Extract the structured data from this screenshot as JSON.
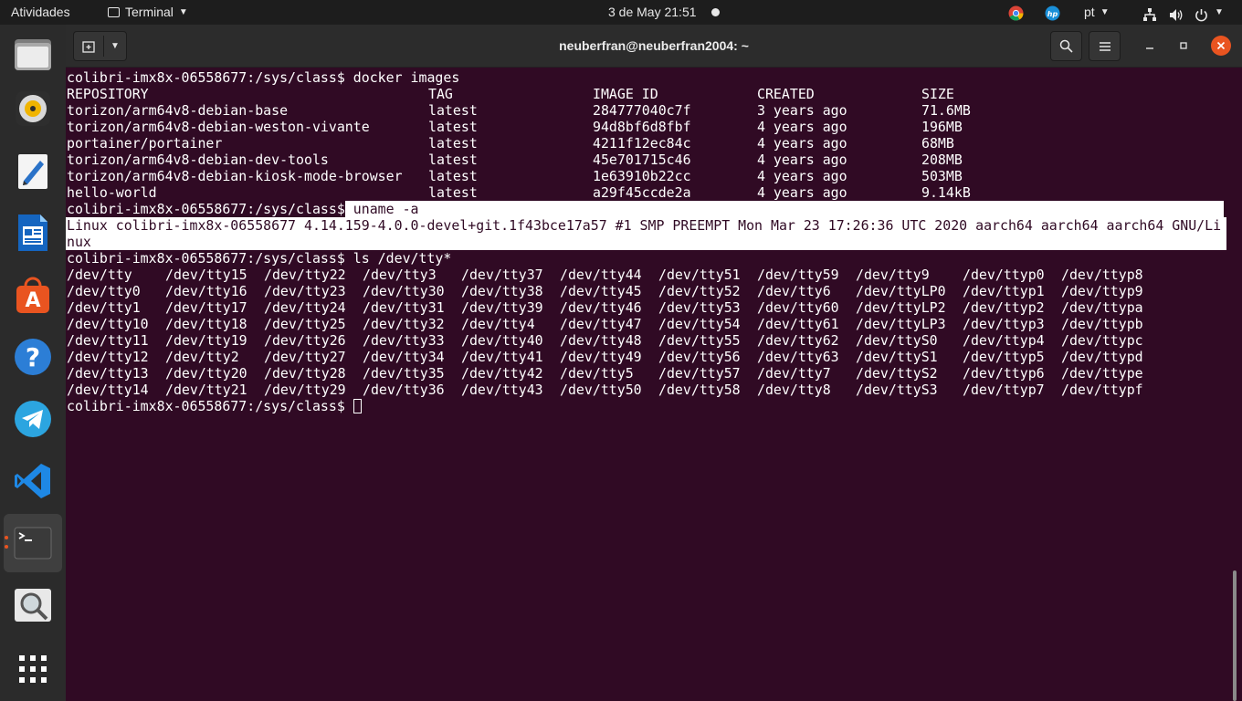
{
  "topbar": {
    "activities": "Atividades",
    "app_menu": "Terminal",
    "clock": "3 de May  21:51",
    "language": "pt"
  },
  "dock": {
    "apps": [
      {
        "name": "files-icon"
      },
      {
        "name": "rhythmbox-icon"
      },
      {
        "name": "text-editor-icon"
      },
      {
        "name": "libreoffice-writer-icon"
      },
      {
        "name": "software-center-icon"
      },
      {
        "name": "help-icon"
      },
      {
        "name": "telegram-icon"
      },
      {
        "name": "vscode-icon"
      },
      {
        "name": "terminal-icon"
      },
      {
        "name": "image-viewer-icon"
      }
    ]
  },
  "window": {
    "title": "neuberfran@neuberfran2004: ~"
  },
  "terminal": {
    "prompt": "colibri-imx8x-06558677:/sys/class$",
    "cmd1": " docker images",
    "docker_headers": [
      "REPOSITORY",
      "TAG",
      "IMAGE ID",
      "CREATED",
      "SIZE"
    ],
    "docker_rows": [
      [
        "torizon/arm64v8-debian-base",
        "latest",
        "284777040c7f",
        "3 years ago",
        "71.6MB"
      ],
      [
        "torizon/arm64v8-debian-weston-vivante",
        "latest",
        "94d8bf6d8fbf",
        "4 years ago",
        "196MB"
      ],
      [
        "portainer/portainer",
        "latest",
        "4211f12ec84c",
        "4 years ago",
        "68MB"
      ],
      [
        "torizon/arm64v8-debian-dev-tools",
        "latest",
        "45e701715c46",
        "4 years ago",
        "208MB"
      ],
      [
        "torizon/arm64v8-debian-kiosk-mode-browser",
        "latest",
        "1e63910b22cc",
        "4 years ago",
        "503MB"
      ],
      [
        "hello-world",
        "latest",
        "a29f45ccde2a",
        "4 years ago",
        "9.14kB"
      ]
    ],
    "cmd2": " uname -a",
    "uname_line1": "Linux colibri-imx8x-06558677 4.14.159-4.0.0-devel+git.1f43bce17a57 #1 SMP PREEMPT Mon Mar 23 17:26:36 UTC 2020 aarch64 aarch64 aarch64 GNU/Li",
    "uname_line2": "nux",
    "cmd3": " ls /dev/tty*",
    "tty_rows": [
      [
        "/dev/tty",
        "/dev/tty15",
        "/dev/tty22",
        "/dev/tty3",
        "/dev/tty37",
        "/dev/tty44",
        "/dev/tty51",
        "/dev/tty59",
        "/dev/tty9",
        "/dev/ttyp0",
        "/dev/ttyp8"
      ],
      [
        "/dev/tty0",
        "/dev/tty16",
        "/dev/tty23",
        "/dev/tty30",
        "/dev/tty38",
        "/dev/tty45",
        "/dev/tty52",
        "/dev/tty6",
        "/dev/ttyLP0",
        "/dev/ttyp1",
        "/dev/ttyp9"
      ],
      [
        "/dev/tty1",
        "/dev/tty17",
        "/dev/tty24",
        "/dev/tty31",
        "/dev/tty39",
        "/dev/tty46",
        "/dev/tty53",
        "/dev/tty60",
        "/dev/ttyLP2",
        "/dev/ttyp2",
        "/dev/ttypa"
      ],
      [
        "/dev/tty10",
        "/dev/tty18",
        "/dev/tty25",
        "/dev/tty32",
        "/dev/tty4",
        "/dev/tty47",
        "/dev/tty54",
        "/dev/tty61",
        "/dev/ttyLP3",
        "/dev/ttyp3",
        "/dev/ttypb"
      ],
      [
        "/dev/tty11",
        "/dev/tty19",
        "/dev/tty26",
        "/dev/tty33",
        "/dev/tty40",
        "/dev/tty48",
        "/dev/tty55",
        "/dev/tty62",
        "/dev/ttyS0",
        "/dev/ttyp4",
        "/dev/ttypc"
      ],
      [
        "/dev/tty12",
        "/dev/tty2",
        "/dev/tty27",
        "/dev/tty34",
        "/dev/tty41",
        "/dev/tty49",
        "/dev/tty56",
        "/dev/tty63",
        "/dev/ttyS1",
        "/dev/ttyp5",
        "/dev/ttypd"
      ],
      [
        "/dev/tty13",
        "/dev/tty20",
        "/dev/tty28",
        "/dev/tty35",
        "/dev/tty42",
        "/dev/tty5",
        "/dev/tty57",
        "/dev/tty7",
        "/dev/ttyS2",
        "/dev/ttyp6",
        "/dev/ttype"
      ],
      [
        "/dev/tty14",
        "/dev/tty21",
        "/dev/tty29",
        "/dev/tty36",
        "/dev/tty43",
        "/dev/tty50",
        "/dev/tty58",
        "/dev/tty8",
        "/dev/ttyS3",
        "/dev/ttyp7",
        "/dev/ttypf"
      ]
    ]
  }
}
